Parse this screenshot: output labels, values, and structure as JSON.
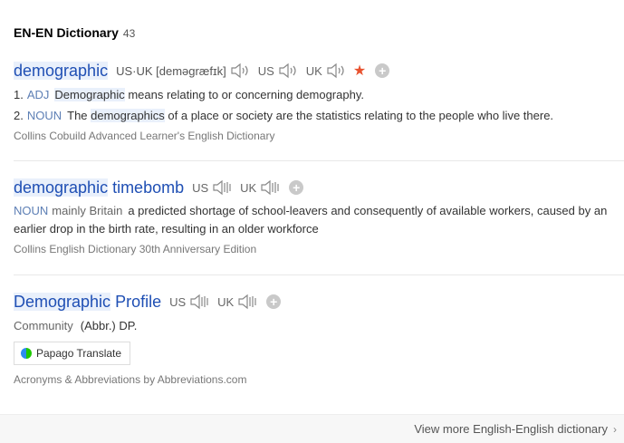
{
  "header": {
    "title": "EN-EN Dictionary",
    "count": "43"
  },
  "entries": [
    {
      "word": "demographic",
      "phonetic": "US·UK [deməɡræfɪk]",
      "us": "US",
      "uk": "UK",
      "definitions": [
        {
          "num": "1.",
          "pos": "ADJ",
          "hl": "Demographic",
          "text": " means relating to or concerning demography."
        },
        {
          "num": "2.",
          "pos": "NOUN",
          "pre": "The ",
          "hl": "demographics",
          "text": " of a place or society are the statistics relating to the people who live there."
        }
      ],
      "source": "Collins Cobuild Advanced Learner's English Dictionary"
    },
    {
      "word_hl": "demographic",
      "word_rest": " timebomb",
      "us": "US",
      "uk": "UK",
      "pos": "NOUN",
      "category": "mainly Britain",
      "definition": "a predicted shortage of school-leavers and consequently of available workers, caused by an earlier drop in the birth rate, resulting in an older workforce",
      "source": "Collins English Dictionary 30th Anniversary Edition"
    },
    {
      "word_hl": "Demographic",
      "word_rest": " Profile",
      "us": "US",
      "uk": "UK",
      "category": "Community",
      "definition": "(Abbr.) DP.",
      "translate_label": "Papago Translate",
      "source": "Acronyms & Abbreviations by Abbreviations.com"
    }
  ],
  "footer": {
    "more_label": "View more English-English dictionary"
  },
  "colors": {
    "link": "#1f4fb4",
    "highlight": "#e9f0fb",
    "star": "#e8522f"
  },
  "icons": [
    "speaker-icon",
    "star-icon",
    "plus-icon",
    "papago-logo-icon",
    "chevron-right-icon"
  ]
}
